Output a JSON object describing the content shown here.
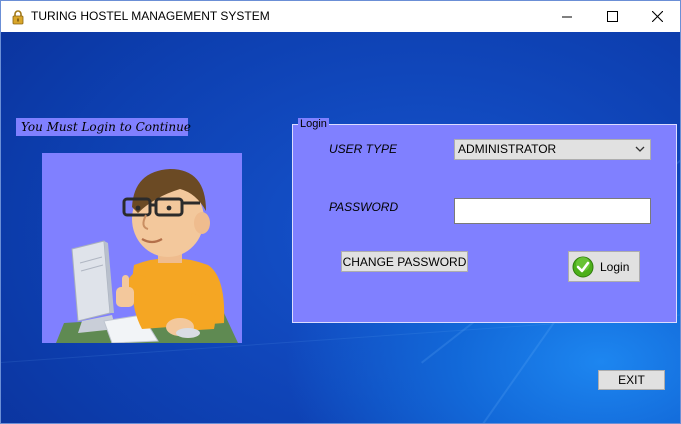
{
  "window": {
    "title": "TURING HOSTEL MANAGEMENT SYSTEM",
    "controls": {
      "minimize": "minimize-icon",
      "maximize": "maximize-icon",
      "close": "close-icon"
    }
  },
  "left_panel": {
    "prompt": "You Must Login to Continue",
    "illustration": "man-at-computer-thumbs-up"
  },
  "login_group": {
    "legend": "Login",
    "user_type_label": "USER TYPE",
    "user_type_value": "ADMINISTRATOR",
    "password_label": "PASSWORD",
    "password_value": "",
    "change_password_label": "CHANGE PASSWORD",
    "login_label": "Login"
  },
  "exit_label": "EXIT",
  "colors": {
    "panel": "#8080ff",
    "desktop": "#0a3fb8",
    "button": "#e1e1e1",
    "titlebar": "#ffffff"
  }
}
